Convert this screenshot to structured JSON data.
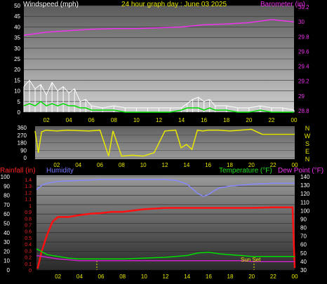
{
  "chart_data": [
    {
      "type": "line",
      "title": "24 hour graph day : June 03 2025",
      "left_axis_label": "Windspeed (mph)",
      "right_axis_label": "Barometer (in)",
      "x_ticks": [
        "02",
        "04",
        "06",
        "08",
        "10",
        "12",
        "14",
        "16",
        "18",
        "20",
        "22",
        "00"
      ],
      "y_left_ticks": [
        0,
        5,
        10,
        15,
        20,
        25,
        30,
        35,
        40,
        45,
        50
      ],
      "y_left_range": [
        0,
        50
      ],
      "y_right_ticks": [
        "28.8",
        "29",
        "29.2",
        "29.4",
        "29.6",
        "29.8",
        "30",
        "30.2"
      ],
      "y_right_range": [
        28.8,
        30.2
      ],
      "series": [
        {
          "axis": "right",
          "color": "#ee33ee",
          "x": [
            0,
            2,
            4,
            6,
            8,
            10,
            12,
            14,
            16,
            18,
            20,
            22,
            24
          ],
          "values": [
            29.82,
            29.86,
            29.88,
            29.9,
            29.91,
            29.91,
            29.92,
            29.93,
            29.96,
            29.97,
            29.99,
            30.03,
            30.0
          ]
        },
        {
          "axis": "left",
          "color": "#ffffff",
          "x": [
            0,
            0.5,
            1,
            1.5,
            2,
            2.5,
            3,
            3.5,
            4,
            4.5,
            5,
            5.5,
            6,
            7,
            8,
            9,
            10,
            11,
            12,
            13,
            14,
            14.5,
            15,
            15.5,
            16,
            16.5,
            17,
            18,
            19,
            20,
            21,
            22,
            23,
            24
          ],
          "values": [
            12,
            15,
            11,
            13,
            8,
            14,
            10,
            12,
            9,
            11,
            5,
            6,
            3,
            2,
            3,
            2,
            2,
            2,
            2,
            2,
            2,
            4,
            6,
            7,
            5,
            6,
            3,
            3,
            2,
            2,
            3,
            2,
            2,
            1
          ]
        },
        {
          "axis": "left",
          "color": "#00dd00",
          "x": [
            0,
            0.5,
            1,
            1.5,
            2,
            2.5,
            3,
            3.5,
            4,
            4.5,
            5,
            5.5,
            6,
            7,
            8,
            9,
            10,
            11,
            12,
            13,
            14,
            14.5,
            15,
            15.5,
            16,
            16.5,
            17,
            18,
            19,
            20,
            21,
            22,
            23,
            24
          ],
          "values": [
            3,
            4,
            3,
            5,
            3,
            4,
            3,
            4,
            3,
            3,
            2,
            2,
            1,
            1,
            1,
            0,
            0,
            0,
            0,
            0,
            1,
            2,
            2,
            2,
            1,
            2,
            1,
            1,
            0,
            0,
            1,
            0,
            0,
            0
          ]
        }
      ]
    },
    {
      "type": "line",
      "right_axis_letters": [
        "N",
        "W",
        "S",
        "E",
        "N"
      ],
      "x_ticks": [
        "02",
        "04",
        "06",
        "08",
        "10",
        "12",
        "14",
        "16",
        "18",
        "20",
        "22",
        "00"
      ],
      "y_left_ticks": [
        0,
        90,
        180,
        270,
        360
      ],
      "y_left_range": [
        0,
        360
      ],
      "series": [
        {
          "color": "#e8e800",
          "x": [
            0,
            0.3,
            0.6,
            1,
            2,
            3,
            4,
            5,
            6,
            6.8,
            7.2,
            8,
            9,
            10,
            11,
            12,
            13,
            13.5,
            14,
            14.5,
            15,
            15.5,
            16,
            17,
            18,
            19,
            20,
            21,
            22,
            23,
            24
          ],
          "values": [
            320,
            60,
            310,
            330,
            320,
            330,
            325,
            320,
            330,
            20,
            320,
            20,
            30,
            20,
            60,
            320,
            330,
            120,
            160,
            100,
            330,
            320,
            330,
            330,
            320,
            330,
            340,
            280,
            280,
            280,
            280
          ]
        }
      ]
    },
    {
      "type": "line",
      "left_axis_label_1": "Rainfall (in)",
      "left_axis_label_2": "Humidity",
      "right_axis_label_1": "Temperature (°F)",
      "right_axis_label_2": "Dew Point (°F)",
      "annotation": "Sun Set",
      "x_ticks": [
        "02",
        "04",
        "06",
        "08",
        "10",
        "12",
        "14",
        "16",
        "18",
        "20",
        "22",
        "00"
      ],
      "humidity_ticks": [
        0,
        10,
        20,
        30,
        40,
        50,
        60,
        70,
        80,
        90,
        100
      ],
      "humidity_range": [
        0,
        100
      ],
      "rain_ticks": [
        "0",
        "0.1",
        "0.2",
        "0.3",
        "0.4",
        "0.5",
        "0.6",
        "0.7",
        "0.8",
        "0.9",
        "1",
        "1.1",
        "1.2",
        "1.3",
        "1.4"
      ],
      "rain_range": [
        0,
        1.4
      ],
      "temp_ticks": [
        30,
        40,
        50,
        60,
        70,
        80,
        90,
        100,
        110,
        120,
        130,
        140
      ],
      "temp_range": [
        30,
        140
      ],
      "series": [
        {
          "name": "Rainfall",
          "color": "#ff1111",
          "x": [
            0.1,
            0.5,
            1,
            1.5,
            2,
            3,
            4,
            5,
            6,
            7,
            8,
            9,
            10,
            12,
            14,
            16,
            18,
            20,
            22,
            23.8,
            24
          ],
          "values": [
            0.02,
            0.3,
            0.55,
            0.75,
            0.82,
            0.82,
            0.85,
            0.87,
            0.88,
            0.9,
            0.9,
            0.92,
            0.94,
            0.96,
            0.96,
            0.96,
            0.96,
            0.96,
            0.97,
            0.97,
            0.03
          ]
        },
        {
          "name": "Humidity",
          "color": "#8888ff",
          "x": [
            0,
            0.5,
            1,
            2,
            4,
            6,
            8,
            10,
            12,
            13,
            14,
            14.5,
            15,
            15.5,
            16,
            16.5,
            17,
            18,
            19,
            20,
            22,
            24
          ],
          "values": [
            86,
            91,
            93,
            95,
            96,
            97,
            97,
            97,
            97,
            96,
            92,
            87,
            82,
            79,
            81,
            85,
            88,
            90,
            91,
            92,
            93,
            93
          ]
        },
        {
          "name": "Temperature",
          "color": "#00dd00",
          "x": [
            0,
            1,
            2,
            3,
            4,
            6,
            8,
            10,
            12,
            14,
            15,
            16,
            17,
            18,
            19,
            20,
            22,
            24
          ],
          "values": [
            55,
            48,
            46,
            44,
            43,
            43,
            43,
            44,
            45,
            47,
            50,
            51,
            49,
            48,
            47,
            46,
            46,
            46
          ]
        },
        {
          "name": "Dew Point",
          "color": "#cc22cc",
          "x": [
            0,
            1,
            2,
            3,
            4,
            6,
            8,
            10,
            12,
            14,
            15,
            16,
            17,
            18,
            19,
            20,
            22,
            24
          ],
          "values": [
            47,
            45,
            43,
            42,
            41,
            41,
            41,
            41,
            41,
            41,
            41,
            41,
            41,
            41,
            41,
            40,
            40,
            40
          ]
        }
      ]
    }
  ]
}
